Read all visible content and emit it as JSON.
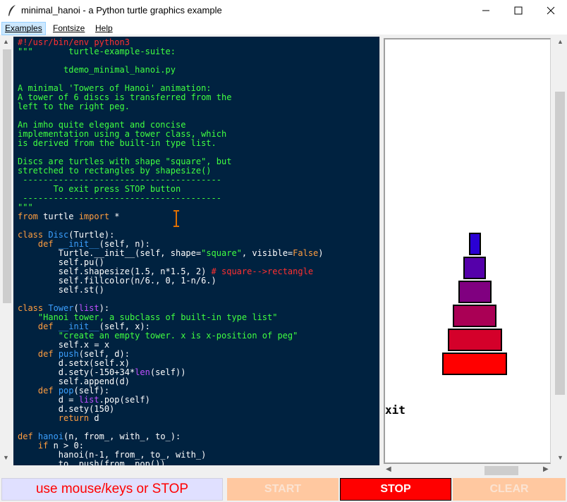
{
  "window": {
    "title": "minimal_hanoi - a Python turtle graphics example"
  },
  "menu": {
    "items": [
      "Examples",
      "Fontsize",
      "Help"
    ]
  },
  "code_lines": [
    [
      [
        "c-comment",
        "#!/usr/bin/env python3"
      ]
    ],
    [
      [
        "c-string",
        "\"\"\"       turtle-example-suite:"
      ]
    ],
    [
      [
        "c-string",
        ""
      ]
    ],
    [
      [
        "c-string",
        "         tdemo_minimal_hanoi.py"
      ]
    ],
    [
      [
        "c-string",
        ""
      ]
    ],
    [
      [
        "c-string",
        "A minimal 'Towers of Hanoi' animation:"
      ]
    ],
    [
      [
        "c-string",
        "A tower of 6 discs is transferred from the"
      ]
    ],
    [
      [
        "c-string",
        "left to the right peg."
      ]
    ],
    [
      [
        "c-string",
        ""
      ]
    ],
    [
      [
        "c-string",
        "An imho quite elegant and concise"
      ]
    ],
    [
      [
        "c-string",
        "implementation using a tower class, which"
      ]
    ],
    [
      [
        "c-string",
        "is derived from the built-in type list."
      ]
    ],
    [
      [
        "c-string",
        ""
      ]
    ],
    [
      [
        "c-string",
        "Discs are turtles with shape \"square\", but"
      ]
    ],
    [
      [
        "c-string",
        "stretched to rectangles by shapesize()"
      ]
    ],
    [
      [
        "c-string",
        " ---------------------------------------"
      ]
    ],
    [
      [
        "c-string",
        "       To exit press STOP button"
      ]
    ],
    [
      [
        "c-string",
        " ---------------------------------------"
      ]
    ],
    [
      [
        "c-string",
        "\"\"\""
      ]
    ],
    [
      [
        "c-kw",
        "from"
      ],
      [
        "c-normal",
        " turtle "
      ],
      [
        "c-kw",
        "import"
      ],
      [
        "c-normal",
        " *"
      ]
    ],
    [
      [
        "c-normal",
        ""
      ]
    ],
    [
      [
        "c-kw",
        "class"
      ],
      [
        "c-normal",
        " "
      ],
      [
        "c-def",
        "Disc"
      ],
      [
        "c-normal",
        "(Turtle):"
      ]
    ],
    [
      [
        "c-normal",
        "    "
      ],
      [
        "c-kw",
        "def"
      ],
      [
        "c-normal",
        " "
      ],
      [
        "c-def",
        "__init__"
      ],
      [
        "c-normal",
        "(self, n):"
      ]
    ],
    [
      [
        "c-normal",
        "        Turtle.__init__(self, shape="
      ],
      [
        "c-string",
        "\"square\""
      ],
      [
        "c-normal",
        ", visible="
      ],
      [
        "c-kw",
        "False"
      ],
      [
        "c-normal",
        ")"
      ]
    ],
    [
      [
        "c-normal",
        "        self.pu()"
      ]
    ],
    [
      [
        "c-normal",
        "        self.shapesize(1.5, n*1.5, 2) "
      ],
      [
        "c-comment",
        "# square-->rectangle"
      ]
    ],
    [
      [
        "c-normal",
        "        self.fillcolor(n/6., 0, 1-n/6.)"
      ]
    ],
    [
      [
        "c-normal",
        "        self.st()"
      ]
    ],
    [
      [
        "c-normal",
        ""
      ]
    ],
    [
      [
        "c-kw",
        "class"
      ],
      [
        "c-normal",
        " "
      ],
      [
        "c-def",
        "Tower"
      ],
      [
        "c-normal",
        "("
      ],
      [
        "c-builtin",
        "list"
      ],
      [
        "c-normal",
        "):"
      ]
    ],
    [
      [
        "c-normal",
        "    "
      ],
      [
        "c-string",
        "\"Hanoi tower, a subclass of built-in type list\""
      ]
    ],
    [
      [
        "c-normal",
        "    "
      ],
      [
        "c-kw",
        "def"
      ],
      [
        "c-normal",
        " "
      ],
      [
        "c-def",
        "__init__"
      ],
      [
        "c-normal",
        "(self, x):"
      ]
    ],
    [
      [
        "c-normal",
        "        "
      ],
      [
        "c-string",
        "\"create an empty tower. x is x-position of peg\""
      ]
    ],
    [
      [
        "c-normal",
        "        self.x = x"
      ]
    ],
    [
      [
        "c-normal",
        "    "
      ],
      [
        "c-kw",
        "def"
      ],
      [
        "c-normal",
        " "
      ],
      [
        "c-def",
        "push"
      ],
      [
        "c-normal",
        "(self, d):"
      ]
    ],
    [
      [
        "c-normal",
        "        d.setx(self.x)"
      ]
    ],
    [
      [
        "c-normal",
        "        d.sety(-150+34*"
      ],
      [
        "c-builtin",
        "len"
      ],
      [
        "c-normal",
        "(self))"
      ]
    ],
    [
      [
        "c-normal",
        "        self.append(d)"
      ]
    ],
    [
      [
        "c-normal",
        "    "
      ],
      [
        "c-kw",
        "def"
      ],
      [
        "c-normal",
        " "
      ],
      [
        "c-def",
        "pop"
      ],
      [
        "c-normal",
        "(self):"
      ]
    ],
    [
      [
        "c-normal",
        "        d = "
      ],
      [
        "c-builtin",
        "list"
      ],
      [
        "c-normal",
        ".pop(self)"
      ]
    ],
    [
      [
        "c-normal",
        "        d.sety(150)"
      ]
    ],
    [
      [
        "c-normal",
        "        "
      ],
      [
        "c-kw",
        "return"
      ],
      [
        "c-normal",
        " d"
      ]
    ],
    [
      [
        "c-normal",
        ""
      ]
    ],
    [
      [
        "c-kw",
        "def"
      ],
      [
        "c-normal",
        " "
      ],
      [
        "c-def",
        "hanoi"
      ],
      [
        "c-normal",
        "(n, from_, with_, to_):"
      ]
    ],
    [
      [
        "c-normal",
        "    "
      ],
      [
        "c-kw",
        "if"
      ],
      [
        "c-normal",
        " n > 0:"
      ]
    ],
    [
      [
        "c-normal",
        "        hanoi(n-1, from_, to_, with_)"
      ]
    ],
    [
      [
        "c-normal",
        "        to_.push(from_.pop())"
      ]
    ]
  ],
  "discs": [
    {
      "n": 1,
      "color": "#2a00d4"
    },
    {
      "n": 2,
      "color": "#5500aa"
    },
    {
      "n": 3,
      "color": "#800080"
    },
    {
      "n": 4,
      "color": "#aa0055"
    },
    {
      "n": 5,
      "color": "#d4002a"
    },
    {
      "n": 6,
      "color": "#ff0000"
    }
  ],
  "canvas_text": "xit",
  "status": "use mouse/keys or STOP",
  "buttons": {
    "start": "START",
    "stop": "STOP",
    "clear": "CLEAR"
  },
  "colors": {
    "code_background": "#002240",
    "stop_button": "#ff0000",
    "inactive_button": "#ffc8a0",
    "status_background": "#e0e0ff"
  }
}
